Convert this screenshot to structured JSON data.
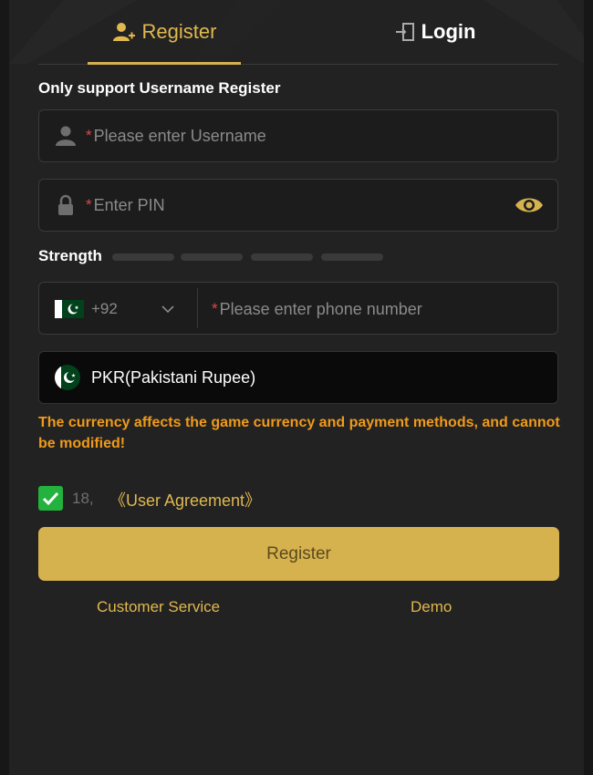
{
  "tabs": {
    "register_label": "Register",
    "login_label": "Login"
  },
  "form": {
    "section_title": "Only support Username Register",
    "required_mark": "*",
    "username_placeholder": "Please enter Username",
    "pin_placeholder": "Enter PIN",
    "strength_label": "Strength",
    "country_code": "+92",
    "phone_placeholder": "Please enter phone number",
    "currency": "PKR(Pakistani Rupee)",
    "currency_warning": "The currency affects the game currency and payment methods, and cannot be modified!",
    "age_text": "18,",
    "agreement_label": "《User Agreement》",
    "agreement_checked": true,
    "register_button": "Register"
  },
  "footer": {
    "customer_service": "Customer Service",
    "demo": "Demo"
  },
  "icons": {
    "register_tab": "user-plus-icon",
    "login_tab": "login-door-icon",
    "username": "user-icon",
    "pin": "lock-icon",
    "show_pin": "eye-icon",
    "country_flag": "pakistan-flag-icon",
    "dropdown": "chevron-down-icon",
    "currency_flag": "pakistan-flag-icon",
    "checkbox": "checkmark-icon"
  },
  "colors": {
    "accent_gold": "#d6b24e",
    "warning_orange": "#f09a1a",
    "required_red": "#e04848",
    "checkbox_green": "#22b23d"
  }
}
